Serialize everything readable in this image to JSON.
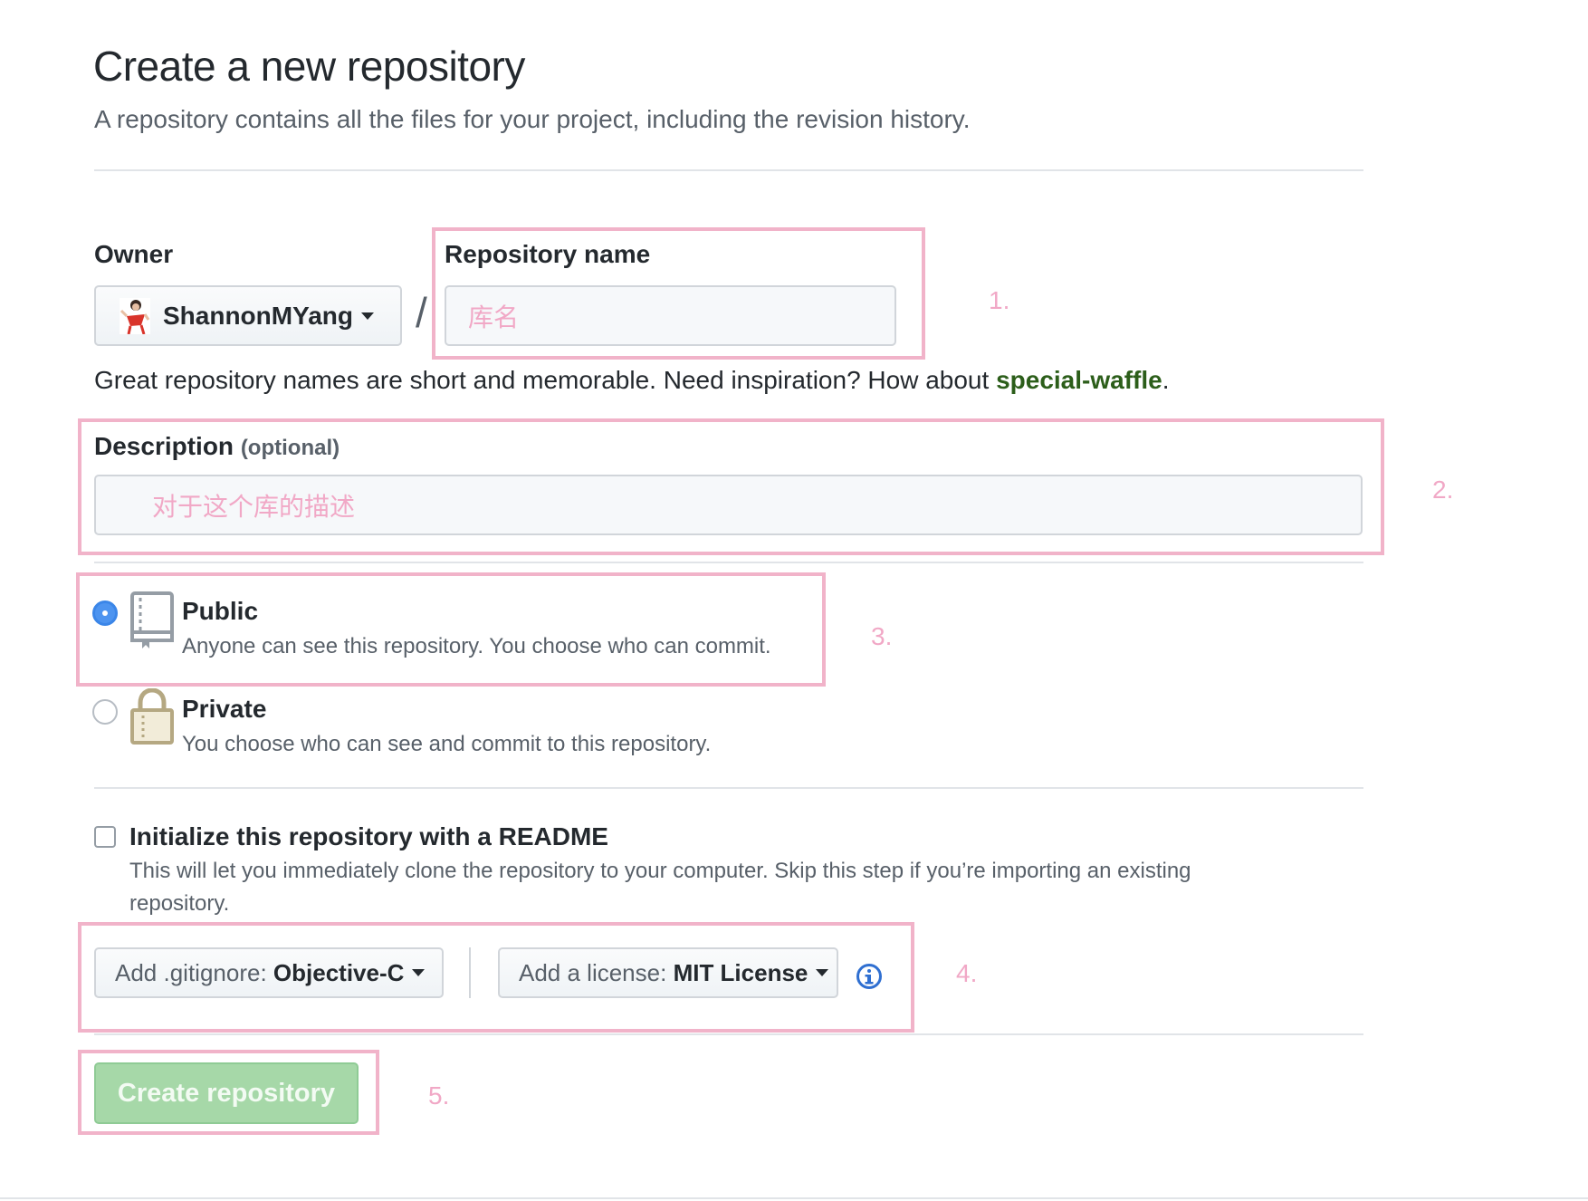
{
  "header": {
    "title": "Create a new repository",
    "subtitle": "A repository contains all the files for your project, including the revision history."
  },
  "owner": {
    "label": "Owner",
    "value": "ShannonMYang"
  },
  "separator": "/",
  "repo_name": {
    "label": "Repository name",
    "placeholder": "库名",
    "hint_prefix": "Great repository names are short and memorable. Need inspiration? How about ",
    "hint_suggestion": "special-waffle",
    "hint_suffix": "."
  },
  "description": {
    "label": "Description",
    "optional": "(optional)",
    "placeholder": "对于这个库的描述"
  },
  "visibility": {
    "public": {
      "title": "Public",
      "desc": "Anyone can see this repository. You choose who can commit.",
      "checked": true
    },
    "private": {
      "title": "Private",
      "desc": "You choose who can see and commit to this repository.",
      "checked": false
    }
  },
  "readme": {
    "title": "Initialize this repository with a README",
    "desc_line1": "This will let you immediately clone the repository to your computer. Skip this step if you’re importing an existing",
    "desc_line2": "repository.",
    "checked": false
  },
  "gitignore": {
    "prefix": "Add .gitignore:",
    "value": "Objective-C"
  },
  "license": {
    "prefix": "Add a license:",
    "value": "MIT License"
  },
  "info_icon": "info-icon",
  "create_button": {
    "label": "Create repository"
  },
  "annotations": {
    "step1": "1.",
    "step2": "2.",
    "step3": "3.",
    "step4": "4.",
    "step5": "5."
  },
  "colors": {
    "annotation_pink": "#f1b3c9",
    "suggestion_green": "#2c5e1a",
    "radio_blue": "#4d94f0",
    "create_button_green": "#a6d8a8"
  }
}
